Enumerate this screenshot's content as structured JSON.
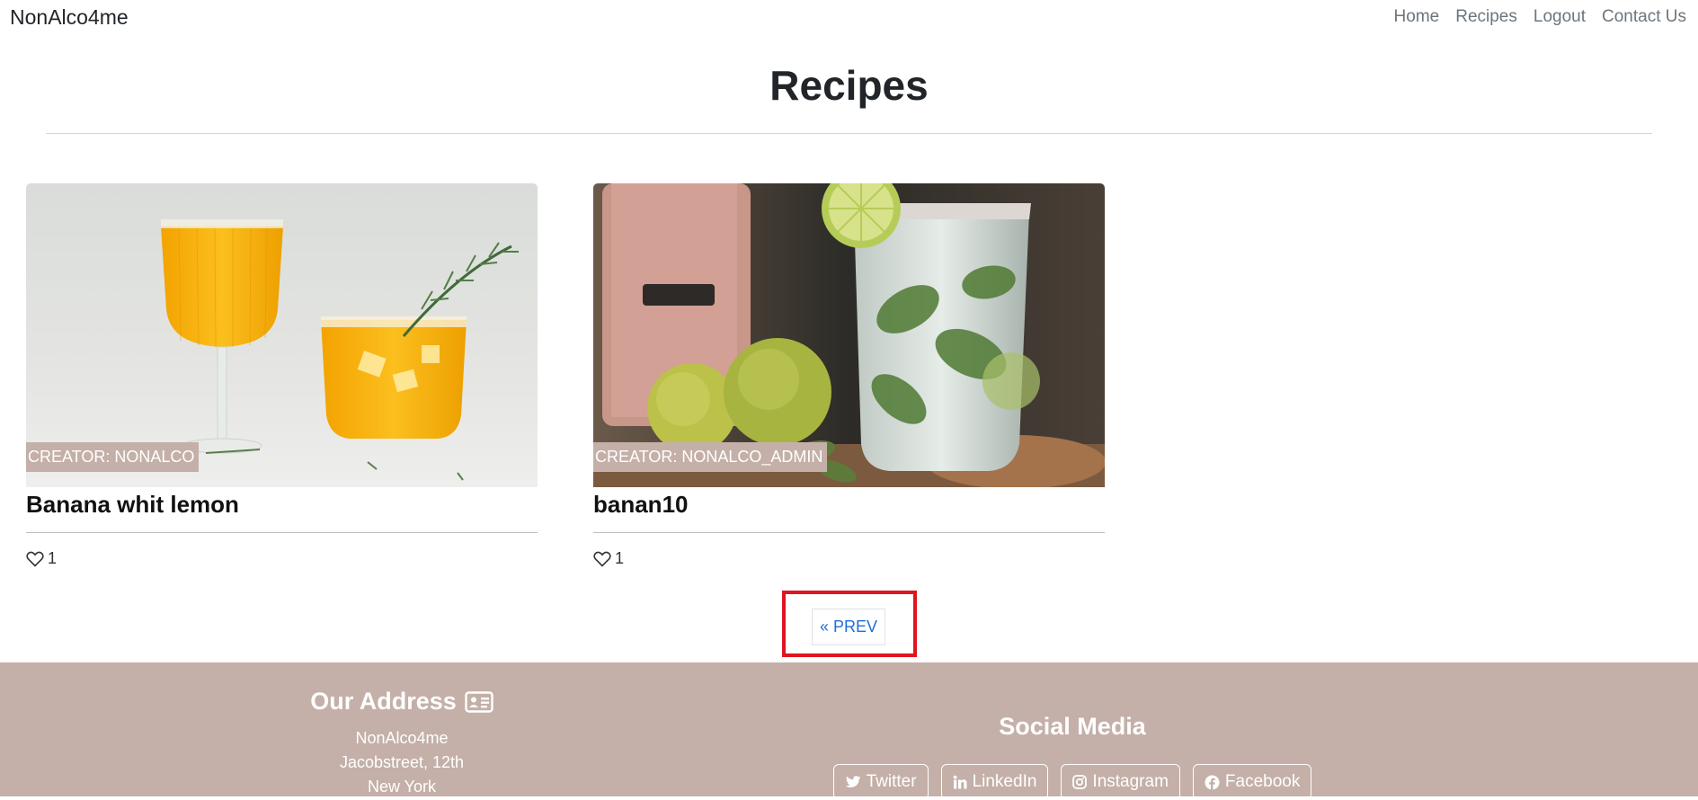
{
  "nav": {
    "brand": "NonAlco4me",
    "links": [
      "Home",
      "Recipes",
      "Logout",
      "Contact Us"
    ]
  },
  "page": {
    "title": "Recipes"
  },
  "cards": [
    {
      "creator": "CREATOR: NONALCO",
      "title": "Banana whit lemon",
      "likes": "1"
    },
    {
      "creator": "CREATOR: NONALCO_ADMIN",
      "title": "banan10",
      "likes": "1"
    }
  ],
  "pagination": {
    "prev_label": "« PREV"
  },
  "footer": {
    "address_heading": "Our Address",
    "address_lines": [
      "NonAlco4me",
      "Jacobstreet, 12th",
      "New York"
    ],
    "social_heading": "Social Media",
    "social_buttons": [
      "Twitter",
      "LinkedIn",
      "Instagram",
      "Facebook"
    ]
  },
  "colors": {
    "accent": "#c4b0a8",
    "link": "#1e6fd9",
    "highlight": "#e0141f"
  }
}
